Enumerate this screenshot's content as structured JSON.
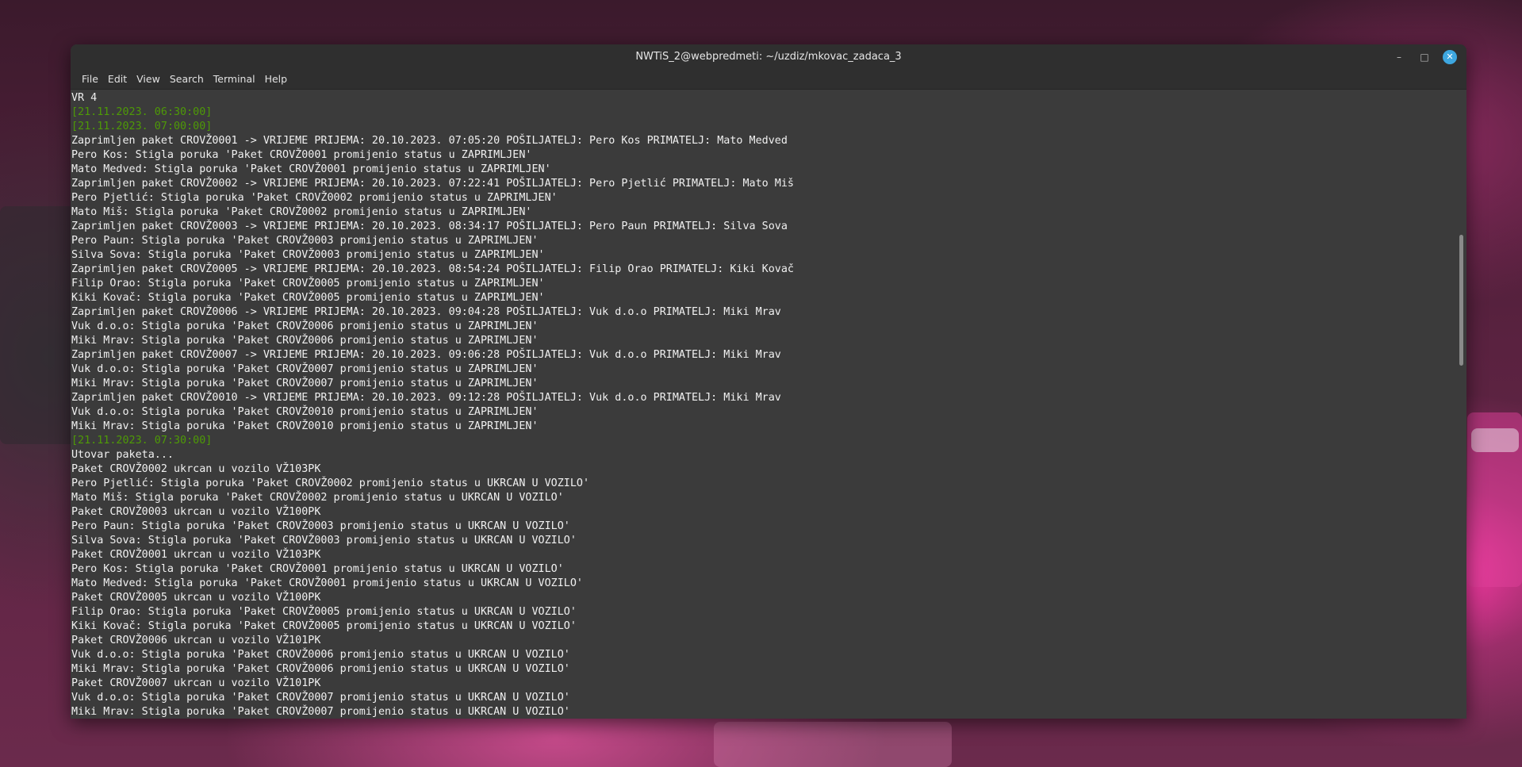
{
  "window": {
    "title": "NWTiS_2@webpredmeti: ~/uzdiz/mkovac_zadaca_3",
    "controls": {
      "minimize": "–",
      "maximize": "□",
      "close": "✕"
    }
  },
  "menu": [
    "File",
    "Edit",
    "View",
    "Search",
    "Terminal",
    "Help"
  ],
  "terminal": {
    "lines": [
      {
        "text": "VR 4",
        "type": "normal"
      },
      {
        "text": "[21.11.2023. 06:30:00]",
        "type": "ts"
      },
      {
        "text": "[21.11.2023. 07:00:00]",
        "type": "ts"
      },
      {
        "text": "Zaprimljen paket CROVŽ0001 -> VRIJEME PRIJEMA: 20.10.2023. 07:05:20 POŠILJATELJ: Pero Kos PRIMATELJ: Mato Medved",
        "type": "normal"
      },
      {
        "text": "Pero Kos: Stigla poruka 'Paket CROVŽ0001 promijenio status u ZAPRIMLJEN'",
        "type": "normal"
      },
      {
        "text": "Mato Medved: Stigla poruka 'Paket CROVŽ0001 promijenio status u ZAPRIMLJEN'",
        "type": "normal"
      },
      {
        "text": "Zaprimljen paket CROVŽ0002 -> VRIJEME PRIJEMA: 20.10.2023. 07:22:41 POŠILJATELJ: Pero Pjetlić PRIMATELJ: Mato Miš",
        "type": "normal"
      },
      {
        "text": "Pero Pjetlić: Stigla poruka 'Paket CROVŽ0002 promijenio status u ZAPRIMLJEN'",
        "type": "normal"
      },
      {
        "text": "Mato Miš: Stigla poruka 'Paket CROVŽ0002 promijenio status u ZAPRIMLJEN'",
        "type": "normal"
      },
      {
        "text": "Zaprimljen paket CROVŽ0003 -> VRIJEME PRIJEMA: 20.10.2023. 08:34:17 POŠILJATELJ: Pero Paun PRIMATELJ: Silva Sova",
        "type": "normal"
      },
      {
        "text": "Pero Paun: Stigla poruka 'Paket CROVŽ0003 promijenio status u ZAPRIMLJEN'",
        "type": "normal"
      },
      {
        "text": "Silva Sova: Stigla poruka 'Paket CROVŽ0003 promijenio status u ZAPRIMLJEN'",
        "type": "normal"
      },
      {
        "text": "Zaprimljen paket CROVŽ0005 -> VRIJEME PRIJEMA: 20.10.2023. 08:54:24 POŠILJATELJ: Filip Orao PRIMATELJ: Kiki Kovač",
        "type": "normal"
      },
      {
        "text": "Filip Orao: Stigla poruka 'Paket CROVŽ0005 promijenio status u ZAPRIMLJEN'",
        "type": "normal"
      },
      {
        "text": "Kiki Kovač: Stigla poruka 'Paket CROVŽ0005 promijenio status u ZAPRIMLJEN'",
        "type": "normal"
      },
      {
        "text": "Zaprimljen paket CROVŽ0006 -> VRIJEME PRIJEMA: 20.10.2023. 09:04:28 POŠILJATELJ: Vuk d.o.o PRIMATELJ: Miki Mrav",
        "type": "normal"
      },
      {
        "text": "Vuk d.o.o: Stigla poruka 'Paket CROVŽ0006 promijenio status u ZAPRIMLJEN'",
        "type": "normal"
      },
      {
        "text": "Miki Mrav: Stigla poruka 'Paket CROVŽ0006 promijenio status u ZAPRIMLJEN'",
        "type": "normal"
      },
      {
        "text": "Zaprimljen paket CROVŽ0007 -> VRIJEME PRIJEMA: 20.10.2023. 09:06:28 POŠILJATELJ: Vuk d.o.o PRIMATELJ: Miki Mrav",
        "type": "normal"
      },
      {
        "text": "Vuk d.o.o: Stigla poruka 'Paket CROVŽ0007 promijenio status u ZAPRIMLJEN'",
        "type": "normal"
      },
      {
        "text": "Miki Mrav: Stigla poruka 'Paket CROVŽ0007 promijenio status u ZAPRIMLJEN'",
        "type": "normal"
      },
      {
        "text": "Zaprimljen paket CROVŽ0010 -> VRIJEME PRIJEMA: 20.10.2023. 09:12:28 POŠILJATELJ: Vuk d.o.o PRIMATELJ: Miki Mrav",
        "type": "normal"
      },
      {
        "text": "Vuk d.o.o: Stigla poruka 'Paket CROVŽ0010 promijenio status u ZAPRIMLJEN'",
        "type": "normal"
      },
      {
        "text": "Miki Mrav: Stigla poruka 'Paket CROVŽ0010 promijenio status u ZAPRIMLJEN'",
        "type": "normal"
      },
      {
        "text": "[21.11.2023. 07:30:00]",
        "type": "ts"
      },
      {
        "text": "Utovar paketa...",
        "type": "normal"
      },
      {
        "text": "Paket CROVŽ0002 ukrcan u vozilo VŽ103PK",
        "type": "normal"
      },
      {
        "text": "Pero Pjetlić: Stigla poruka 'Paket CROVŽ0002 promijenio status u UKRCAN U VOZILO'",
        "type": "normal"
      },
      {
        "text": "Mato Miš: Stigla poruka 'Paket CROVŽ0002 promijenio status u UKRCAN U VOZILO'",
        "type": "normal"
      },
      {
        "text": "Paket CROVŽ0003 ukrcan u vozilo VŽ100PK",
        "type": "normal"
      },
      {
        "text": "Pero Paun: Stigla poruka 'Paket CROVŽ0003 promijenio status u UKRCAN U VOZILO'",
        "type": "normal"
      },
      {
        "text": "Silva Sova: Stigla poruka 'Paket CROVŽ0003 promijenio status u UKRCAN U VOZILO'",
        "type": "normal"
      },
      {
        "text": "Paket CROVŽ0001 ukrcan u vozilo VŽ103PK",
        "type": "normal"
      },
      {
        "text": "Pero Kos: Stigla poruka 'Paket CROVŽ0001 promijenio status u UKRCAN U VOZILO'",
        "type": "normal"
      },
      {
        "text": "Mato Medved: Stigla poruka 'Paket CROVŽ0001 promijenio status u UKRCAN U VOZILO'",
        "type": "normal"
      },
      {
        "text": "Paket CROVŽ0005 ukrcan u vozilo VŽ100PK",
        "type": "normal"
      },
      {
        "text": "Filip Orao: Stigla poruka 'Paket CROVŽ0005 promijenio status u UKRCAN U VOZILO'",
        "type": "normal"
      },
      {
        "text": "Kiki Kovač: Stigla poruka 'Paket CROVŽ0005 promijenio status u UKRCAN U VOZILO'",
        "type": "normal"
      },
      {
        "text": "Paket CROVŽ0006 ukrcan u vozilo VŽ101PK",
        "type": "normal"
      },
      {
        "text": "Vuk d.o.o: Stigla poruka 'Paket CROVŽ0006 promijenio status u UKRCAN U VOZILO'",
        "type": "normal"
      },
      {
        "text": "Miki Mrav: Stigla poruka 'Paket CROVŽ0006 promijenio status u UKRCAN U VOZILO'",
        "type": "normal"
      },
      {
        "text": "Paket CROVŽ0007 ukrcan u vozilo VŽ101PK",
        "type": "normal"
      },
      {
        "text": "Vuk d.o.o: Stigla poruka 'Paket CROVŽ0007 promijenio status u UKRCAN U VOZILO'",
        "type": "normal"
      },
      {
        "text": "Miki Mrav: Stigla poruka 'Paket CROVŽ0007 promijenio status u UKRCAN U VOZILO'",
        "type": "normal"
      }
    ]
  },
  "colors": {
    "timestamp": "#4e9a06",
    "text": "#f0f0f0",
    "background": "#3b3b3b",
    "close_button": "#3ea7e0"
  }
}
